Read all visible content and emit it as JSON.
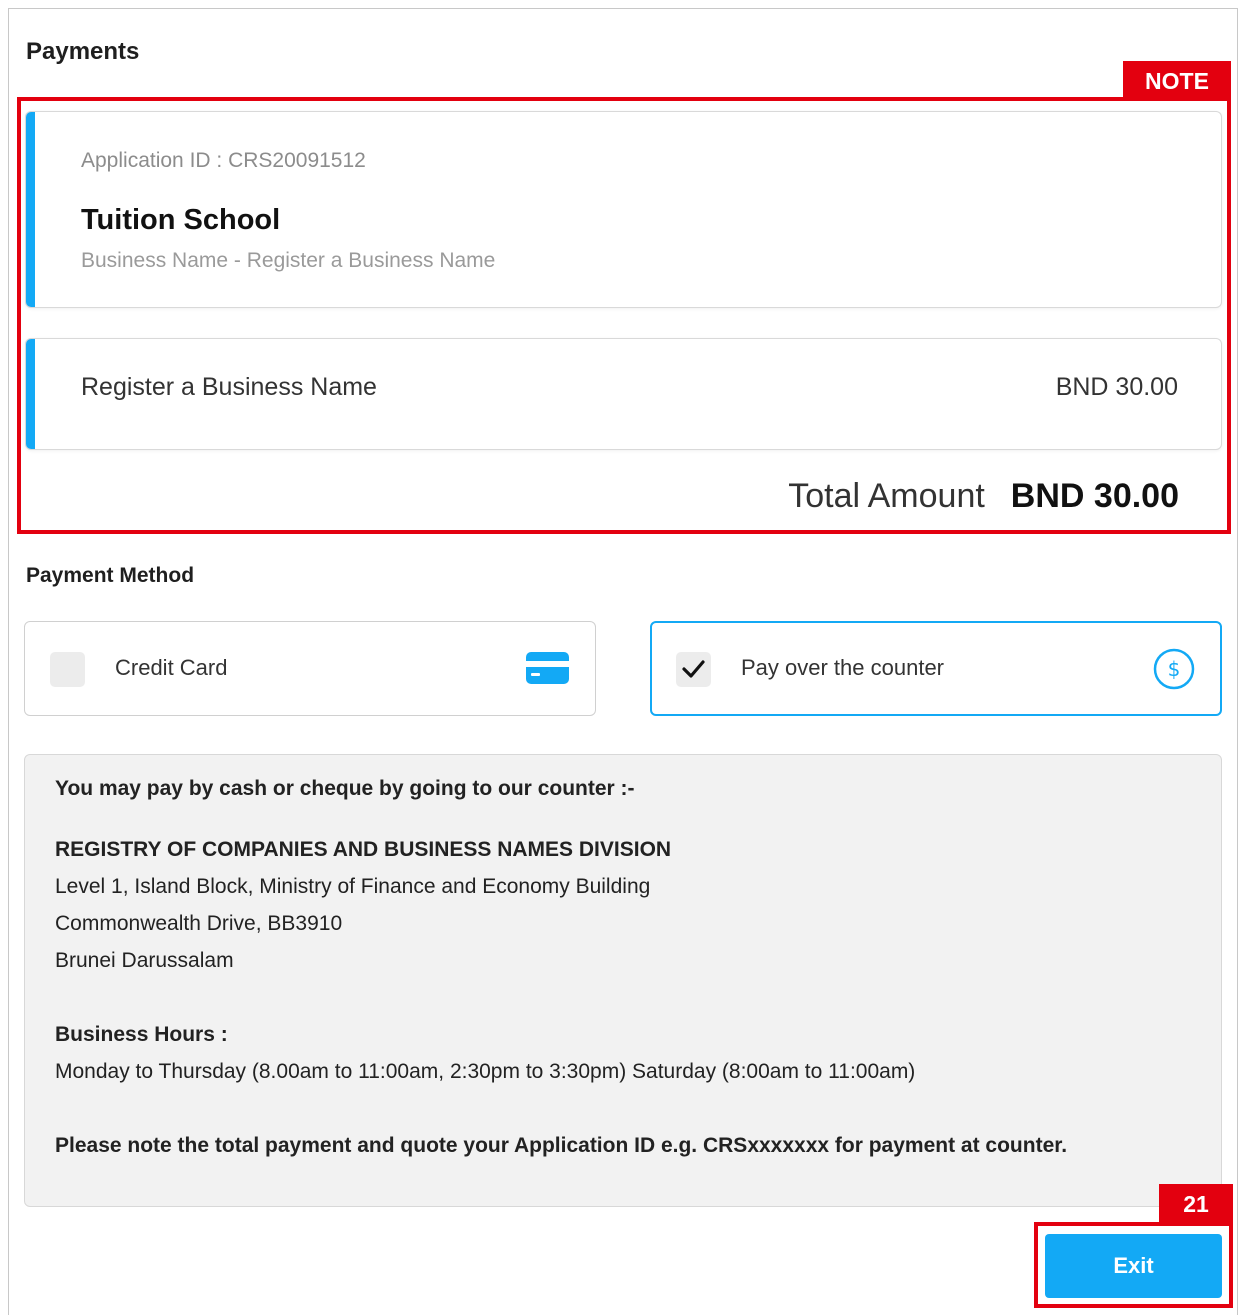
{
  "header": {
    "title": "Payments"
  },
  "annotations": {
    "note_label": "NOTE",
    "step_number": "21"
  },
  "application": {
    "id_text": "Application ID : CRS20091512",
    "name": "Tuition School",
    "subtitle": "Business Name - Register a Business Name"
  },
  "line_item": {
    "label": "Register a Business Name",
    "amount": "BND 30.00"
  },
  "total": {
    "label": "Total Amount",
    "value": "BND 30.00"
  },
  "payment_method": {
    "title": "Payment Method",
    "options": [
      {
        "label": "Credit Card",
        "selected": false,
        "icon": "credit-card-icon"
      },
      {
        "label": "Pay over the counter",
        "selected": true,
        "icon": "dollar-circle-icon"
      }
    ]
  },
  "counter_info": {
    "intro": "You may pay by cash or cheque by going to our counter  :-",
    "office_name": "REGISTRY OF COMPANIES AND BUSINESS NAMES DIVISION",
    "address_line1": "Level 1, Island Block, Ministry of Finance and Economy Building",
    "address_line2": "Commonwealth Drive, BB3910",
    "address_line3": "Brunei Darussalam",
    "hours_title": "Business Hours  :",
    "hours": "Monday to Thursday (8.00am to 11:00am, 2:30pm to 3:30pm) Saturday (8:00am to 11:00am)",
    "note": "Please note the total payment and quote your Application ID e.g. CRSxxxxxxx for payment at counter."
  },
  "actions": {
    "exit_label": "Exit"
  },
  "colors": {
    "accent": "#13a9f5",
    "highlight": "#e3000f",
    "info_bg": "#f2f2f2"
  }
}
